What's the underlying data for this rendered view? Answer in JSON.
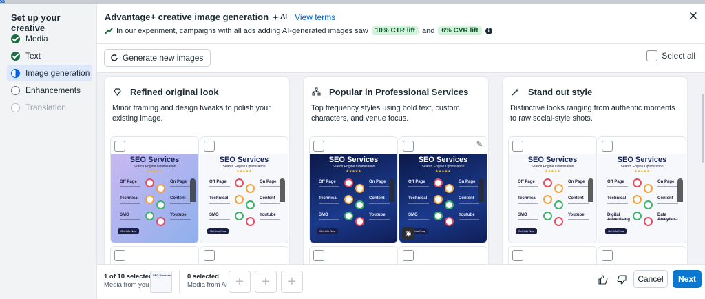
{
  "sidebar": {
    "title": "Set up your creative",
    "steps": [
      {
        "label": "Media",
        "state": "done"
      },
      {
        "label": "Text",
        "state": "done"
      },
      {
        "label": "Image generation",
        "state": "active"
      },
      {
        "label": "Enhancements",
        "state": "pending"
      },
      {
        "label": "Translation",
        "state": "disabled"
      }
    ]
  },
  "header": {
    "title": "Advantage+ creative image generation",
    "ai_badge": "AI",
    "view_terms": "View terms",
    "experiment_text": "In our experiment, campaigns with all ads adding AI-generated images saw",
    "ctr_lift": "10% CTR lift",
    "and_word": "and",
    "cvr_lift": "6% CVR lift"
  },
  "toolbar": {
    "generate_label": "Generate new images",
    "select_all_label": "Select all"
  },
  "cards": [
    {
      "title": "Refined original look",
      "icon": "diamond-icon",
      "description": "Minor framing and design tweaks to polish your existing image."
    },
    {
      "title": "Popular in Professional Services",
      "icon": "building-icon",
      "description": "Top frequency styles using bold text, custom characters, and venue focus."
    },
    {
      "title": "Stand out style",
      "icon": "sparkle-icon",
      "description": "Distinctive looks ranging from authentic moments to raw social-style shots."
    }
  ],
  "poster": {
    "heading": "SEO Services",
    "subheading": "Search Engine Optimisation",
    "items_left": [
      "Off Page",
      "Technical",
      "SMO"
    ],
    "items_right": [
      "On Page",
      "Content",
      "Youtube"
    ],
    "items_left_alt": [
      "Off Page",
      "Technical",
      "Digital Advertising"
    ],
    "items_right_alt": [
      "On Page",
      "Content",
      "Data Analytics"
    ],
    "cta": "Get Info Now"
  },
  "footer": {
    "selected_you": "1 of 10 selected",
    "media_you": "Media from you",
    "selected_ai": "0 selected",
    "media_ai": "Media from AI",
    "cancel": "Cancel",
    "next": "Next"
  },
  "colors": {
    "accent": "#0064e0",
    "done": "#1b6e45",
    "lift_bg": "#d6f2dc"
  }
}
